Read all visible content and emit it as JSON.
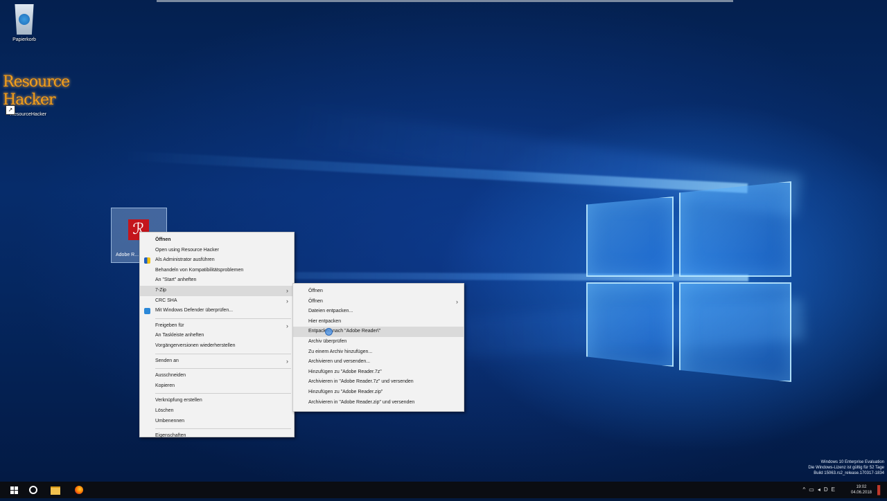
{
  "desktop": {
    "icons": {
      "recycle_bin": "Papierkorb",
      "resource_hacker_logo": "Resource Hacker",
      "resource_hacker": "ResourceHacker",
      "adobe_reader": "Adobe R..."
    },
    "watermark": {
      "line1": "Windows 10 Enterprise Evaluation",
      "line2": "Die Windows-Lizenz ist gültig für 52 Tage",
      "line3": "Build 15063.rs2_release.170317-1834"
    }
  },
  "context_menu": {
    "items": [
      {
        "label": "Öffnen",
        "bold": true
      },
      {
        "label": "Open using Resource Hacker"
      },
      {
        "label": "Als Administrator ausführen",
        "icon": "shield-icon"
      },
      {
        "label": "Behandeln von Kompatibilitätsproblemen"
      },
      {
        "label": "An \"Start\" anheften"
      },
      {
        "label": "7-Zip",
        "submenu": true
      },
      {
        "label": "CRC SHA",
        "submenu": true
      },
      {
        "label": "Mit Windows Defender überprüfen...",
        "icon": "defender-icon"
      },
      {
        "label": "Freigeben für",
        "submenu": true
      },
      {
        "label": "An Taskleiste anheften"
      },
      {
        "label": "Vorgängerversionen wiederherstellen"
      },
      {
        "label": "Senden an",
        "submenu": true
      },
      {
        "label": "Ausschneiden"
      },
      {
        "label": "Kopieren"
      },
      {
        "label": "Verknüpfung erstellen"
      },
      {
        "label": "Löschen"
      },
      {
        "label": "Umbenennen"
      },
      {
        "label": "Eigenschaften"
      }
    ]
  },
  "submenu_7zip": {
    "items": [
      {
        "label": "Öffnen"
      },
      {
        "label": "Öffnen",
        "submenu": true
      },
      {
        "label": "Dateien entpacken..."
      },
      {
        "label": "Hier entpacken"
      },
      {
        "label": "Entpacken nach \"Adobe Reader\\\"",
        "highlighted": true
      },
      {
        "label": "Archiv überprüfen"
      },
      {
        "label": "Zu einem Archiv hinzufügen..."
      },
      {
        "label": "Archivieren und versenden..."
      },
      {
        "label": "Hinzufügen zu \"Adobe Reader.7z\""
      },
      {
        "label": "Archivieren in \"Adobe Reader.7z\" und versenden"
      },
      {
        "label": "Hinzufügen zu \"Adobe Reader.zip\""
      },
      {
        "label": "Archivieren in \"Adobe Reader.zip\" und versenden"
      }
    ]
  },
  "taskbar": {
    "tray_lang": "DE",
    "clock_time": "19:02",
    "clock_date": "04.06.2018"
  },
  "colors": {
    "menu_bg": "#f2f2f2",
    "highlight": "#dadada",
    "taskbar": "#0b0d12",
    "adobe_red": "#c4151c"
  }
}
